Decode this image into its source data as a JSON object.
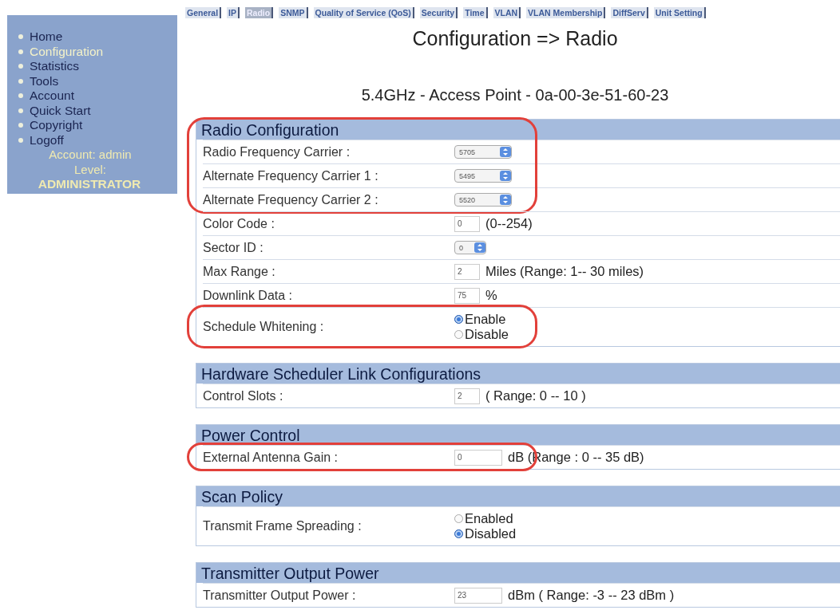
{
  "tabs": [
    {
      "label": "General",
      "selected": false
    },
    {
      "label": "IP",
      "selected": false
    },
    {
      "label": "Radio",
      "selected": true
    },
    {
      "label": "SNMP",
      "selected": false
    },
    {
      "label": "Quality of Service (QoS)",
      "selected": false
    },
    {
      "label": "Security",
      "selected": false
    },
    {
      "label": "Time",
      "selected": false
    },
    {
      "label": "VLAN",
      "selected": false
    },
    {
      "label": "VLAN Membership",
      "selected": false
    },
    {
      "label": "DiffServ",
      "selected": false
    },
    {
      "label": "Unit Setting",
      "selected": false
    }
  ],
  "sidebar": {
    "items": [
      {
        "label": "Home",
        "selected": false
      },
      {
        "label": "Configuration",
        "selected": true
      },
      {
        "label": "Statistics",
        "selected": false
      },
      {
        "label": "Tools",
        "selected": false
      },
      {
        "label": "Account",
        "selected": false
      },
      {
        "label": "Quick Start",
        "selected": false
      },
      {
        "label": "Copyright",
        "selected": false
      },
      {
        "label": "Logoff",
        "selected": false
      }
    ],
    "account": "Account: admin",
    "level_label": "Level:",
    "level": "ADMINISTRATOR"
  },
  "title": "Configuration => Radio",
  "subtitle": "5.4GHz - Access Point - 0a-00-3e-51-60-23",
  "sections": [
    {
      "title": "Radio Configuration",
      "header_circled": true,
      "rows": [
        {
          "kind": "select",
          "label": "Radio Frequency Carrier :",
          "value": "5705",
          "circled": true
        },
        {
          "kind": "select",
          "label": "Alternate Frequency Carrier 1 :",
          "value": "5495",
          "circled": true
        },
        {
          "kind": "select",
          "label": "Alternate Frequency Carrier 2 :",
          "value": "5520",
          "circled": true
        },
        {
          "kind": "text",
          "label": "Color Code :",
          "value": "0",
          "suffix": "(0--254)",
          "circled": false
        },
        {
          "kind": "smallselect",
          "label": "Sector ID :",
          "value": "0",
          "circled": false
        },
        {
          "kind": "text",
          "label": "Max Range :",
          "value": "2",
          "suffix": "Miles (Range: 1-- 30  miles)",
          "circled": false
        },
        {
          "kind": "text",
          "label": "Downlink Data :",
          "value": "75",
          "suffix": "%",
          "circled": false
        },
        {
          "kind": "radio",
          "label": "Schedule Whitening :",
          "options": [
            {
              "label": "Enable",
              "selected": true
            },
            {
              "label": "Disable",
              "selected": false
            }
          ],
          "circled": true
        }
      ]
    },
    {
      "title": "Hardware Scheduler Link Configurations",
      "header_circled": false,
      "rows": [
        {
          "kind": "text",
          "label": "Control Slots :",
          "value": "2",
          "suffix": "( Range: 0 -- 10 )",
          "circled": false
        }
      ]
    },
    {
      "title": "Power Control",
      "header_circled": false,
      "rows": [
        {
          "kind": "wide",
          "label": "External Antenna Gain :",
          "value": "0",
          "suffix": "dB (Range : 0 -- 35 dB)",
          "circled": true
        }
      ]
    },
    {
      "title": "Scan Policy",
      "header_circled": false,
      "rows": [
        {
          "kind": "radio",
          "label": "Transmit Frame Spreading :",
          "options": [
            {
              "label": "Enabled",
              "selected": false
            },
            {
              "label": "Disabled",
              "selected": true
            }
          ],
          "circled": false
        }
      ]
    },
    {
      "title": "Transmitter Output Power",
      "header_circled": false,
      "rows": [
        {
          "kind": "wide",
          "label": "Transmitter Output Power :",
          "value": "23",
          "suffix": "dBm ( Range: -3 -- 23  dBm )",
          "circled": false
        }
      ]
    }
  ]
}
